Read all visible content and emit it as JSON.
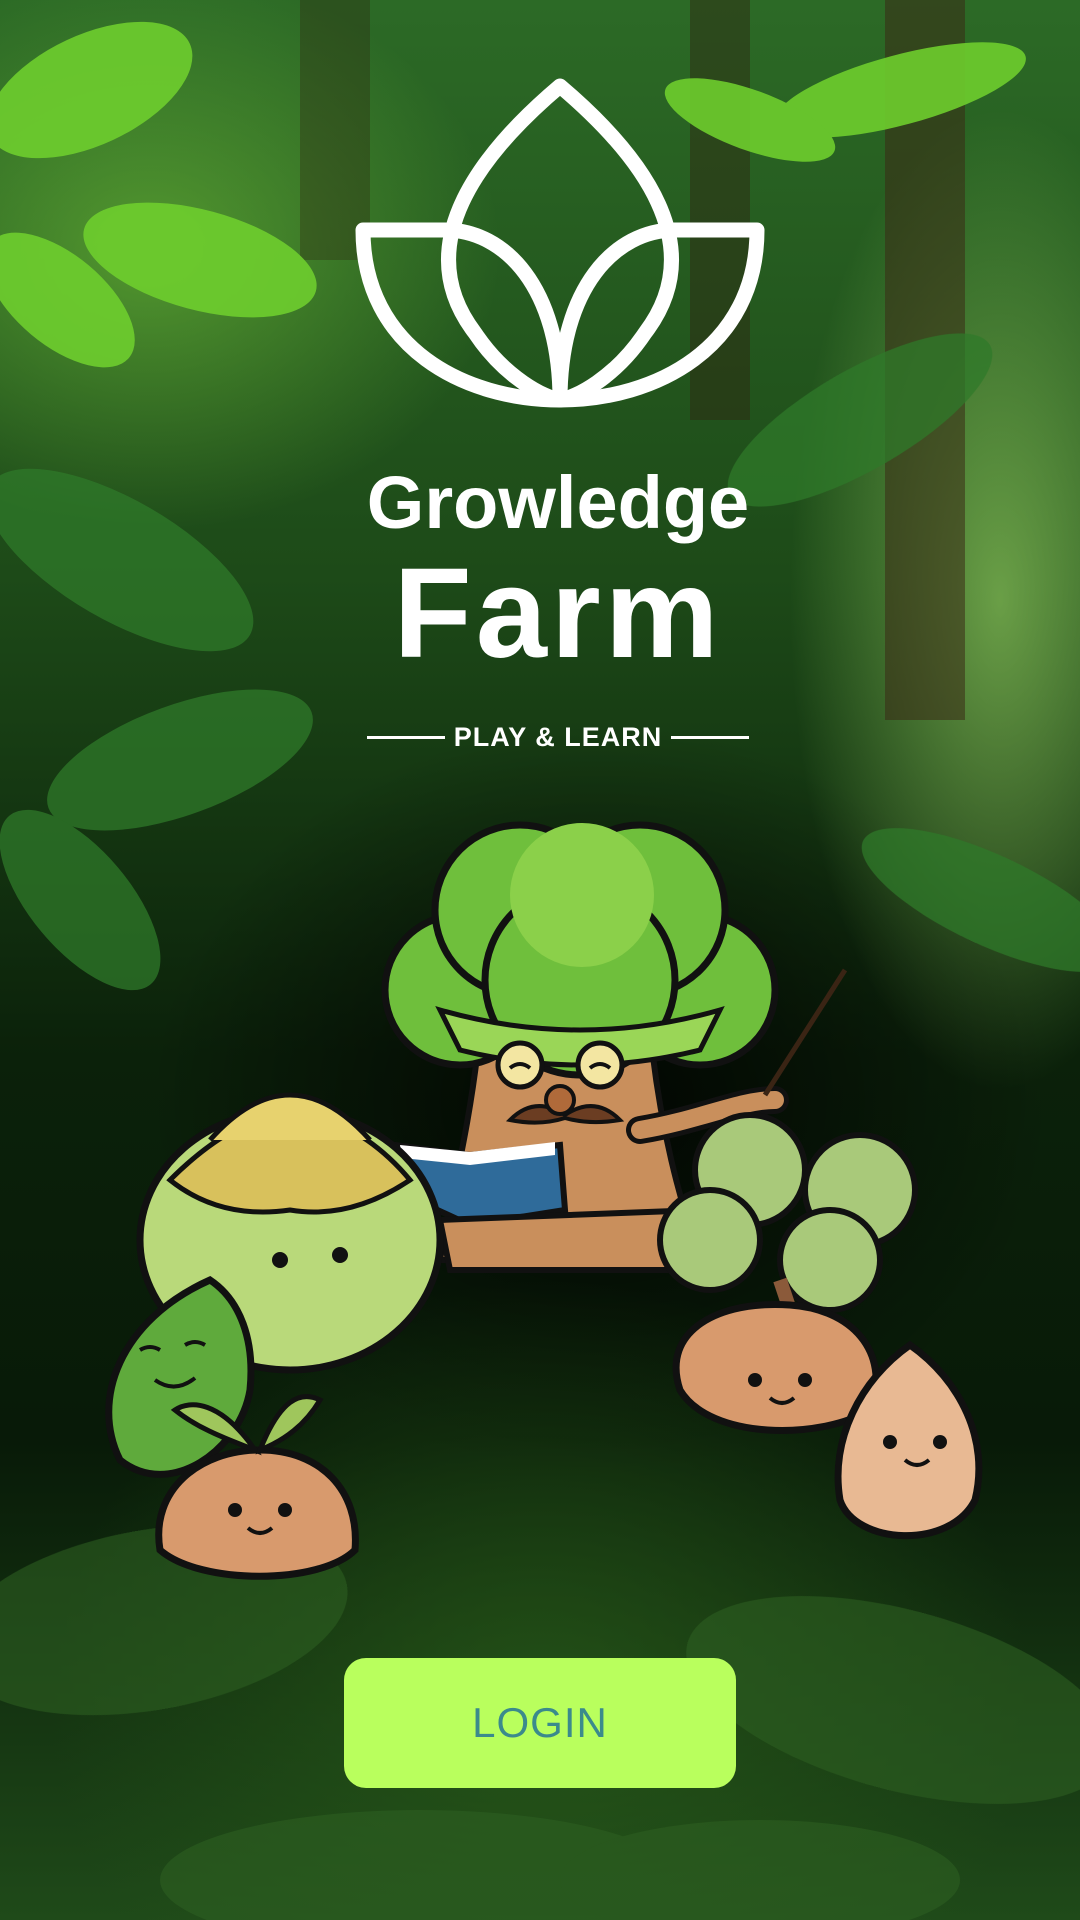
{
  "app": {
    "name_line1": "Growledge",
    "name_line2": "Farm",
    "tagline": "PLAY & LEARN"
  },
  "icons": {
    "logo": "lotus-leaf-logo-icon",
    "mascots": "tree-teacher-and-sprout-characters"
  },
  "actions": {
    "login_label": "LOGIN"
  },
  "colors": {
    "login_bg": "#b9ff5d",
    "login_text": "#3b8a8c",
    "text": "#ffffff"
  }
}
